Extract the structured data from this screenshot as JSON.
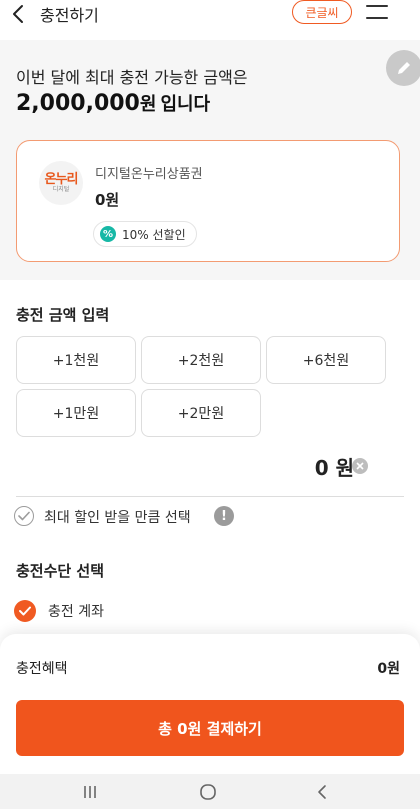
{
  "header": {
    "title": "충전하기",
    "big_text_label": "큰글씨"
  },
  "limit": {
    "line1": "이번 달에 최대 충전 가능한 금액은",
    "amount": "2,000,000",
    "unit": "원",
    "suffix": "입니다"
  },
  "voucher": {
    "logo_text": "온누리",
    "logo_sub": "디지털",
    "name": "디지털온누리상품권",
    "balance": "0원",
    "discount": "10% 선할인",
    "discount_icon": "%"
  },
  "charge_input": {
    "title": "충전 금액 입력",
    "buttons": [
      "+1천원",
      "+2천원",
      "+6천원",
      "+1만원",
      "+2만원"
    ],
    "total": "0 원",
    "max_discount_label": "최대 할인 받을 만큼 선택",
    "info_icon": "!"
  },
  "payment_method": {
    "title": "충전수단 선택",
    "option": "충전 계좌"
  },
  "bottom": {
    "benefit_label": "충전혜택",
    "benefit_value": "0원",
    "pay_button": "총 0원 결제하기"
  },
  "colors": {
    "accent": "#f05a22",
    "teal": "#17b8a6",
    "highlight": "#f9b99c"
  }
}
